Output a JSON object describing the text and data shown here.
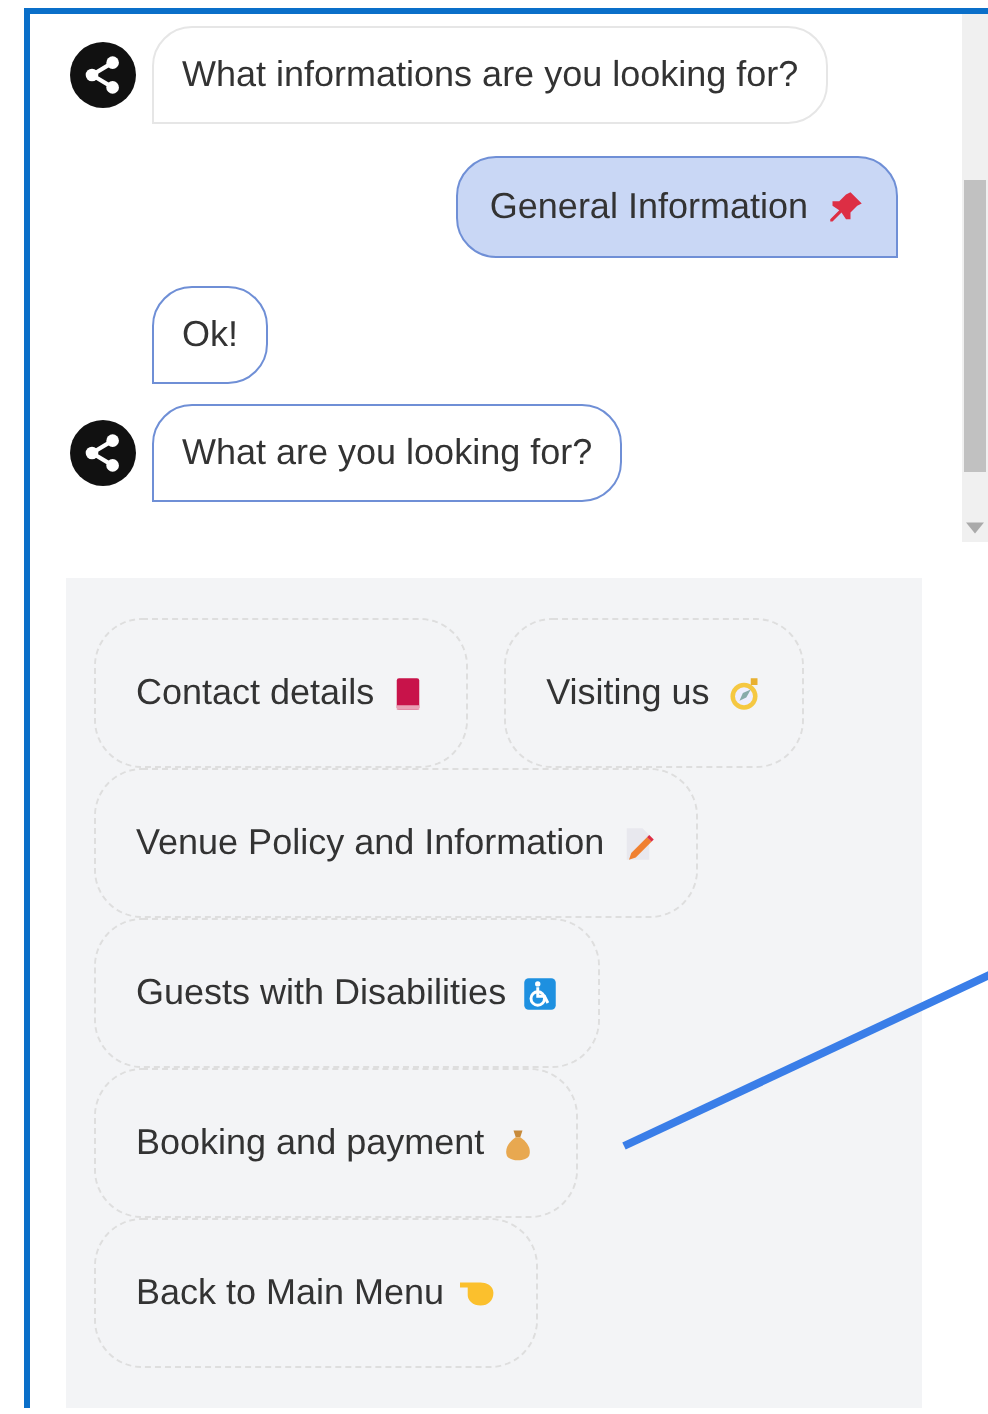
{
  "messages": [
    {
      "kind": "bot",
      "avatar": true,
      "text": "What informations are you looking for?",
      "highlighted": false
    },
    {
      "kind": "user",
      "avatar": false,
      "text": "General Information",
      "highlighted": true
    },
    {
      "kind": "bot",
      "avatar": false,
      "text": "Ok!",
      "highlighted": true
    },
    {
      "kind": "bot",
      "avatar": true,
      "text": "What are you looking for?",
      "highlighted": true
    }
  ],
  "options": [
    {
      "label": "Contact details"
    },
    {
      "label": "Visiting us"
    },
    {
      "label": "Venue Policy and Information"
    },
    {
      "label": "Guests with Disabilities"
    },
    {
      "label": "Booking and payment"
    },
    {
      "label": "Back to Main Menu"
    }
  ]
}
